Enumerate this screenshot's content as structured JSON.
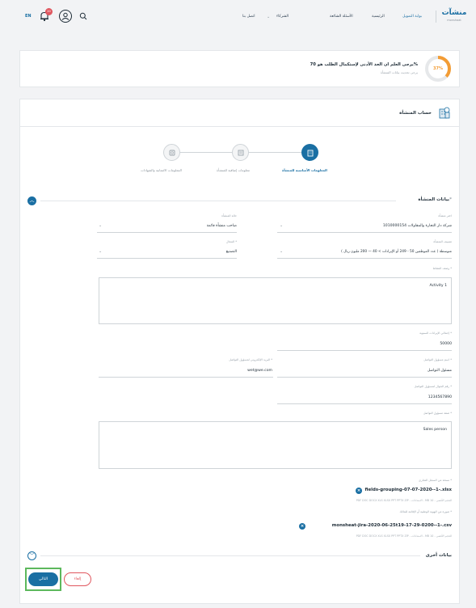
{
  "header": {
    "lang": "EN",
    "notif_count": "20",
    "nav": [
      "اتصل بنا",
      "الشركاء",
      "الأسئلة الشائعة",
      "الرئيسية",
      "بوابة التمويل"
    ],
    "logo": "منشآت",
    "logo_sub": "monshaat"
  },
  "banner": {
    "title": "يرجى العلم ان الحد الأدنى لإستكمال الطلب هو 70%",
    "subtitle": "يرجى تحديث بيانات المنشأة",
    "percent": "37%",
    "progress": 0.37
  },
  "account": {
    "title": "حساب المنشأة"
  },
  "steps": [
    {
      "label": "المعلومات الأساسية للمنشأة",
      "active": true
    },
    {
      "label": "معلومات إضافية للمنشأة",
      "active": false
    },
    {
      "label": "المعلومات الائتمانية والشهادات",
      "active": false
    }
  ],
  "section": {
    "title": "بيانات المنشأة",
    "req": "*"
  },
  "form": {
    "name_label": "اختر منشأة",
    "name_value": "شركة دار التجارة والمقاولات 1010000154",
    "status_label": "حالة المنشأة",
    "status_value": "صاحب منشأة قائمة",
    "class_label": "تصنيف المنشأة",
    "class_value": "متوسطة ( عدد الموظفين 50 - 249 أو الإيرادات > 40 — 200 مليون ريال )",
    "field_label": "المجال *",
    "field_value": "التصنيع",
    "activity_label": "وصف النشاط *",
    "activity_value": "Activity 1",
    "revenue_label": "إجمالي الإيرادات السنوية *",
    "revenue_value": "50000",
    "contact_name_label": "اسم مسؤول التواصل *",
    "contact_name_value": "مسئول التواصل",
    "email_label": "البريد الإلكتروني لمسؤول التواصل *",
    "email_value": "wet@we.com",
    "phone_label": "رقم الجوال لمسؤول التواصل *",
    "phone_value": "1234567890",
    "role_label": "صفة مسؤول التواصل *",
    "role_value": "Sales person",
    "cr_label": "نسخة من السجل التجاري *",
    "cr_file": "fields-grouping-07-07-2020--1-.xlsx",
    "cr_types": "PDF DOC DOCX XLS XLSX PPT PPTX ZIP - الامتدادات - MB 10 - الحجم الأقصى",
    "id_label": "صورة من الهوية الوطنية أو الإقامة للمالك *",
    "id_file": "monsheat-jira-2020-06-25t19-17-29-0200--1-.csv",
    "id_types": "PDF DOC DOCX XLS XLSX PPT PPTX ZIP - الامتدادات - MB 10 - الحجم الأقصى"
  },
  "other": {
    "title": "بيانات أخرى"
  },
  "buttons": {
    "next": "التالي",
    "cancel": "إلغاء"
  },
  "colors": {
    "primary": "#1a6fa3",
    "accent": "#f39c34",
    "highlight": "#5cb85c",
    "cancel": "#e0575f"
  }
}
